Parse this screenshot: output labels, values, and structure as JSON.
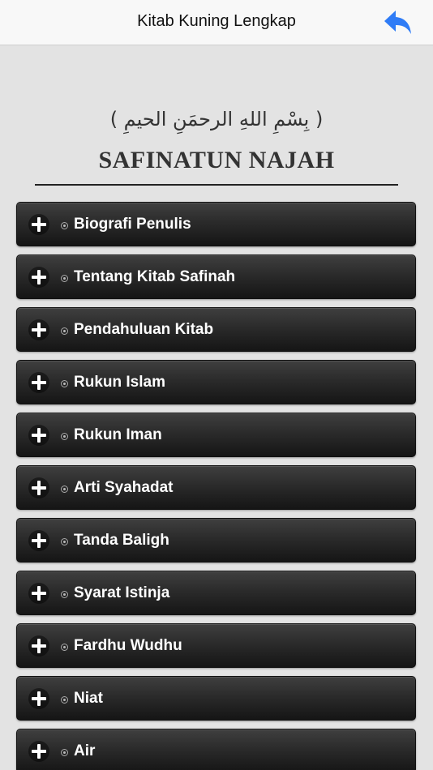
{
  "navbar": {
    "title": "Kitab Kuning Lengkap",
    "back_icon": "reply-arrow-icon",
    "accent_color": "#2f7cf6"
  },
  "header": {
    "basmala": "( بِسْمِ اللهِ الرحمَنِ الحيمِ )",
    "book_title": "SAFINATUN NAJAH"
  },
  "menu": {
    "items": [
      {
        "label": "Biografi Penulis"
      },
      {
        "label": "Tentang Kitab Safinah"
      },
      {
        "label": "Pendahuluan Kitab"
      },
      {
        "label": "Rukun Islam"
      },
      {
        "label": "Rukun Iman"
      },
      {
        "label": "Arti Syahadat"
      },
      {
        "label": "Tanda Baligh"
      },
      {
        "label": "Syarat Istinja"
      },
      {
        "label": "Fardhu Wudhu"
      },
      {
        "label": "Niat"
      },
      {
        "label": "Air"
      }
    ],
    "expand_icon": "plus-icon",
    "bullet_icon": "bullet-dot-icon"
  }
}
